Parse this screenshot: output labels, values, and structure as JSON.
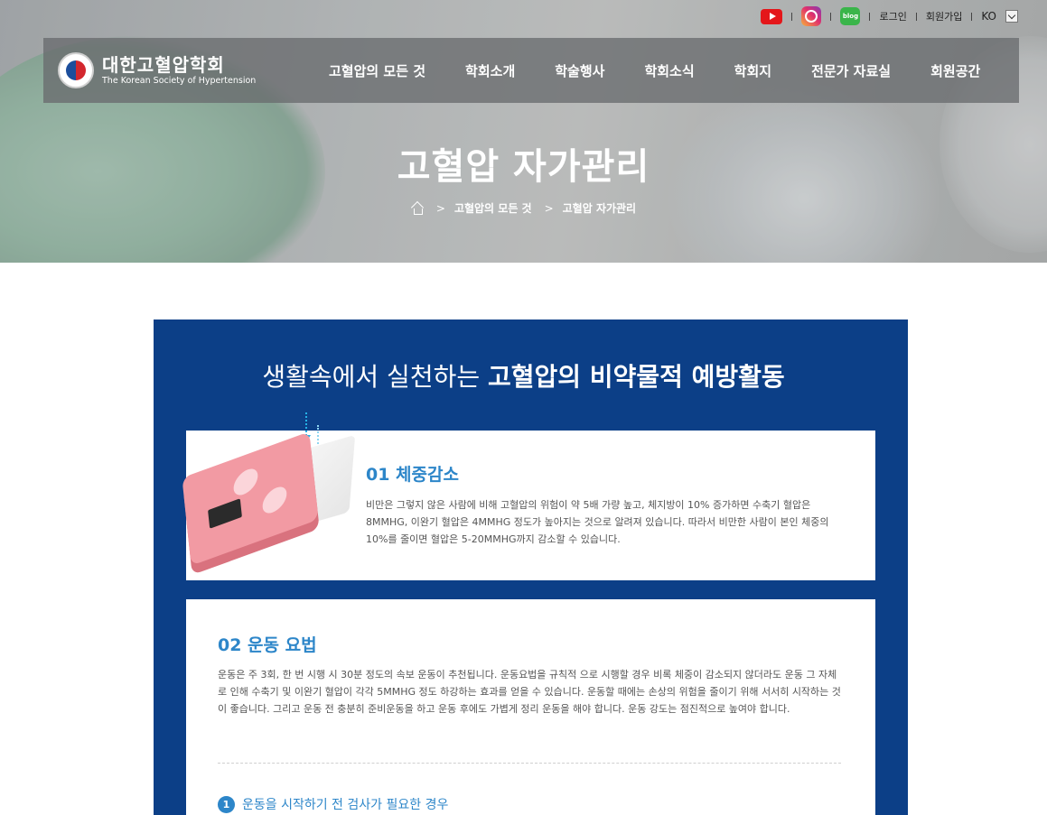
{
  "util": {
    "login": "로그인",
    "signup": "회원가입",
    "lang": "KO",
    "blog_label": "blog"
  },
  "logo": {
    "ko": "대한고혈압학회",
    "en": "The Korean Society of Hypertension"
  },
  "nav": {
    "items": [
      "고혈압의 모든 것",
      "학회소개",
      "학술행사",
      "학회소식",
      "학회지",
      "전문가 자료실",
      "회원공간"
    ]
  },
  "hero": {
    "title": "고혈압 자가관리",
    "breadcrumb": [
      "고혈압의 모든 것",
      "고혈압 자가관리"
    ]
  },
  "section": {
    "title_light": "생활속에서 실천하는",
    "title_bold": "고혈압의 비약물적 예방활동"
  },
  "cards": [
    {
      "title": "01 체중감소",
      "body": "비만은 그렇지 않은 사람에 비해 고혈압의 위험이  약 5배 가량 높고, 체지방이 10% 증가하면 수축기 혈압은 8MMHG, 이완기 혈압은 4MMHG  정도가 높아지는 것으로 알려져 있습니다. 따라서 비만한 사람이 본인 체중의 10%를 줄이면 혈압은 5-20MMHG까지 감소할 수 있습니다."
    },
    {
      "title": "02 운동 요법",
      "body": "운동은 주 3회, 한 번 시행 시 30분 정도의 속보 운동이 추천됩니다. 운동요법을 규칙적 으로 시행할 경우 비록 체중이 감소되지 않더라도 운동 그 자체로 인해 수축기 및 이완기 혈압이 각각  5MMHG 정도 하강하는 효과를 얻을 수 있습니다. 운동할 때에는 손상의 위험을 줄이기 위해 서서히 시작하는 것이 좋습니다. 그리고 운동 전 충분히 준비운동을 하고 운동 후에도 가볍게 정리 운동을 해야 합니다. 운동 강도는 점진적으로 높여야 합니다.",
      "subitems": [
        {
          "num": "1",
          "label": "운동을 시작하기 전 검사가 필요한 경우"
        }
      ]
    }
  ],
  "colors": {
    "section_bg": "#0c3f87",
    "accent": "#2d86c9",
    "youtube": "#e4161a",
    "blog": "#3ab54a"
  }
}
